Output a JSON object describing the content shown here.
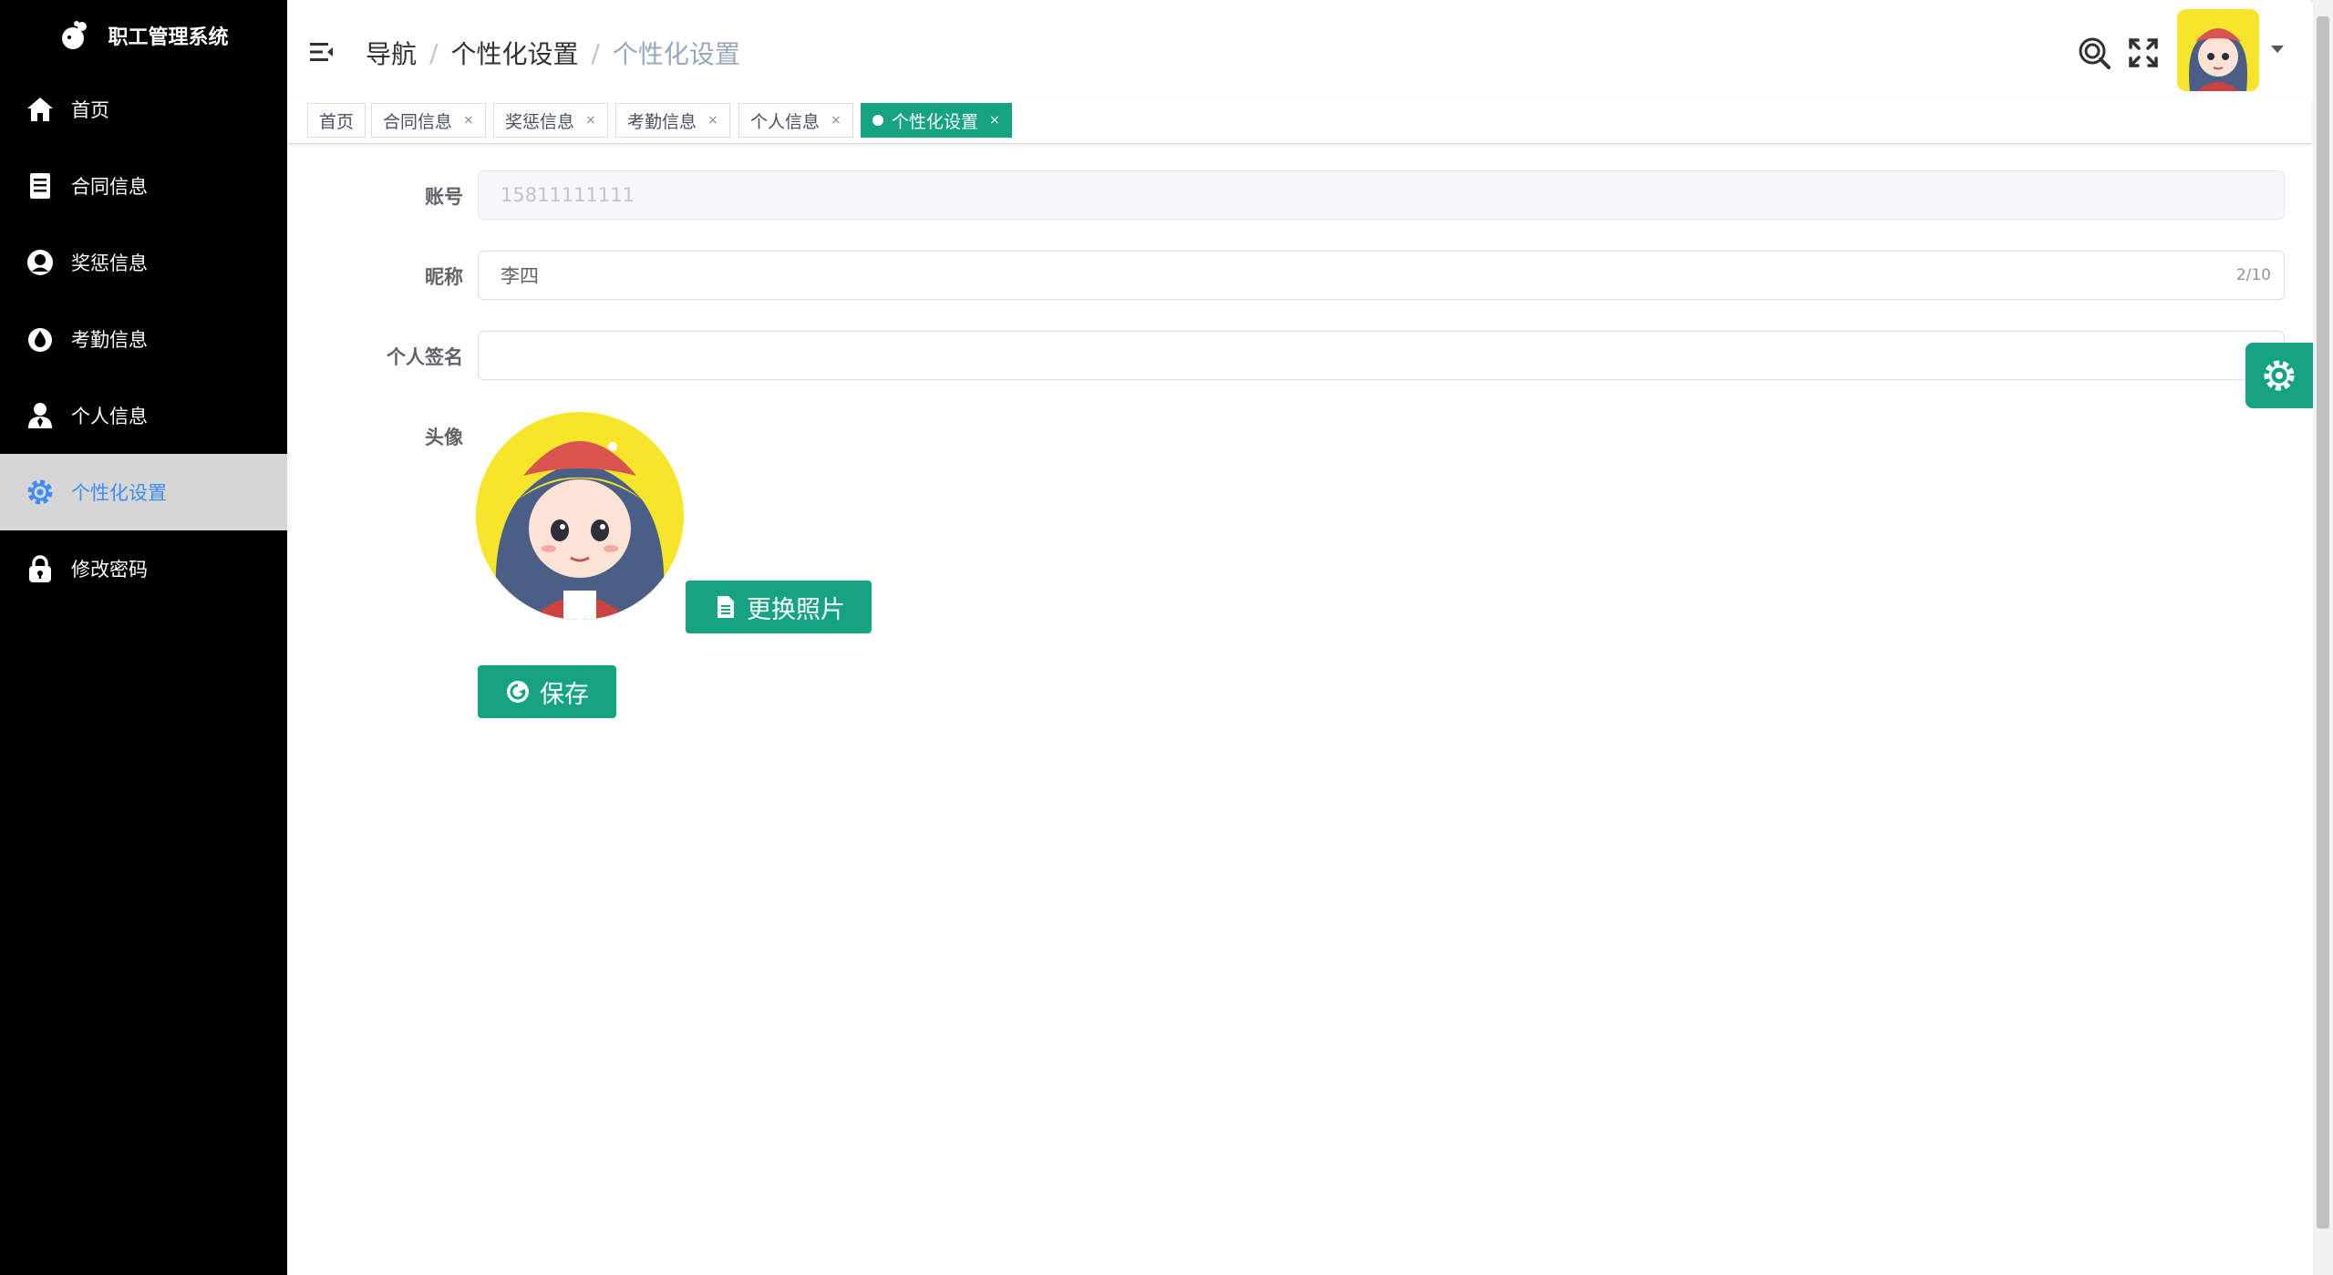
{
  "brand": {
    "title": "职工管理系统"
  },
  "sidebar": {
    "items": [
      {
        "label": "首页",
        "icon": "home-icon"
      },
      {
        "label": "合同信息",
        "icon": "document-icon"
      },
      {
        "label": "奖惩信息",
        "icon": "award-icon"
      },
      {
        "label": "考勤信息",
        "icon": "drop-icon"
      },
      {
        "label": "个人信息",
        "icon": "user-icon"
      },
      {
        "label": "个性化设置",
        "icon": "gear-icon",
        "active": true
      },
      {
        "label": "修改密码",
        "icon": "lock-icon"
      }
    ]
  },
  "header": {
    "breadcrumb": [
      "导航",
      "个性化设置",
      "个性化设置"
    ],
    "separator": "/"
  },
  "tags": [
    {
      "label": "首页",
      "closable": false
    },
    {
      "label": "合同信息",
      "closable": true
    },
    {
      "label": "奖惩信息",
      "closable": true
    },
    {
      "label": "考勤信息",
      "closable": true
    },
    {
      "label": "个人信息",
      "closable": true
    },
    {
      "label": "个性化设置",
      "closable": true,
      "active": true
    }
  ],
  "tag_close": "×",
  "form": {
    "account": {
      "label": "账号",
      "value": "15811111111"
    },
    "nickname": {
      "label": "昵称",
      "value": "李四",
      "counter": "2/10"
    },
    "signature": {
      "label": "个人签名",
      "value": ""
    },
    "avatar": {
      "label": "头像"
    },
    "change_photo_label": "更换照片",
    "save_label": "保存"
  },
  "colors": {
    "accent": "#16a383",
    "sidebar_bg": "#000000",
    "active_text": "#3d8df2"
  }
}
